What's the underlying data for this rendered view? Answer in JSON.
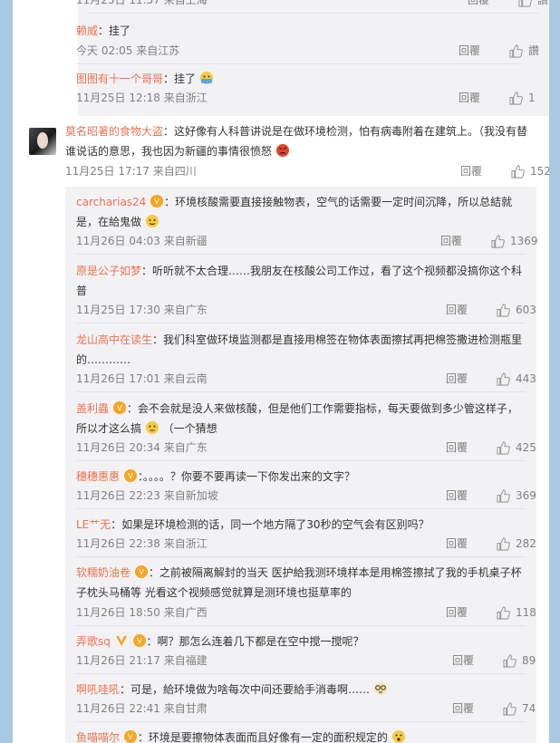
{
  "top_meta": {
    "date": "11月25日 11:57 来自上海",
    "reply": "回覆",
    "like": "讃"
  },
  "replies_group1": [
    {
      "user": "赖威",
      "text": "挂了",
      "date": "今天 02:05 来自江苏",
      "reply": "回覆",
      "like": "讚"
    },
    {
      "user": "图图有十一个哥哥",
      "text": "挂了",
      "date": "11月25日 12:18 来自浙江",
      "reply": "回覆",
      "like": "1"
    }
  ],
  "main_comment": {
    "user": "莫名昭著的食物大盗",
    "text_line1": "这好像有人科普讲说是在做环境检测，怕有病毒附着在建筑上。（我没有替",
    "text_line2": "谁说话的意思，我也因为新疆的事情很愤怒",
    "date": "11月25日 17:17 来自四川",
    "reply": "回覆",
    "like": "152"
  },
  "replies_group2": [
    {
      "user": "carcharias24",
      "line1": "环境核酸需要直接接触物表，空气的话需要一定时间沉降，所以总結就",
      "line2": "是，在給鬼做",
      "date": "11月26日 04:03 来自新疆",
      "reply": "回覆",
      "like": "1369"
    },
    {
      "user": "原是公子如梦",
      "line1": "听听就不太合理……我朋友在核酸公司工作过，看了这个视频都没搞你这个科",
      "line2": "普",
      "date": "11月25日 17:30 来自广东",
      "reply": "回覆",
      "like": "603"
    },
    {
      "user": "龙山高中在读生",
      "line1": "我们科室做环境监测都是直接用棉签在物体表面擦拭再把棉签撒进检测瓶里",
      "line2": "的…………",
      "date": "11月26日 17:01 来自云南",
      "reply": "回覆",
      "like": "443"
    },
    {
      "user": "盖利蟲",
      "line1": "会不会就是没人来做核酸，但是他们工作需要指标，每天要做到多少管这样子，",
      "line2": "所以才这么搞",
      "line2b": "（一个猜想",
      "date": "11月26日 20:34 来自广东",
      "reply": "回覆",
      "like": "425"
    },
    {
      "user": "穗穗惠惠",
      "line1": "。。。。？你要不要再读一下你发出来的文字？",
      "date": "11月26日 22:23 来自新加坡",
      "reply": "回覆",
      "like": "369"
    },
    {
      "user": "LE艹无",
      "line1": "如果是环境检测的话，同一个地方隔了30秒的空气会有区别吗？",
      "date": "11月26日 22:38 来自浙江",
      "reply": "回覆",
      "like": "282"
    },
    {
      "user": "软糯奶油卷",
      "line1": "之前被隔离解封的当天 医护給我测环境样本是用棉签擦拭了我的手机桌子杯",
      "line2": "子枕头马桶等 光看这个视频感觉就算是测环境也挺草率的",
      "date": "11月26日 18:50 来自广西",
      "reply": "回覆",
      "like": "118"
    },
    {
      "user": "弄歌sq",
      "line1": "啊？那怎么连着几下都是在空中搅一搅呢？",
      "date": "11月26日 21:17 来自福建",
      "reply": "回覆",
      "like": "89"
    },
    {
      "user": "啊吼哇吼",
      "line1": "可是，給环境做为啥每次中间还要給手消毒啊……",
      "date": "11月26日 22:41 来自甘肃",
      "reply": "回覆",
      "like": "74"
    },
    {
      "user": "鱼喵喵尔",
      "line1": "环境是要擦物体表面而且好像有一定的面积规定的"
    }
  ],
  "colors": {
    "username": "#eb7350",
    "meta": "#808080",
    "subbox": "#f2f2f5",
    "bg": "#a9c8e2"
  }
}
